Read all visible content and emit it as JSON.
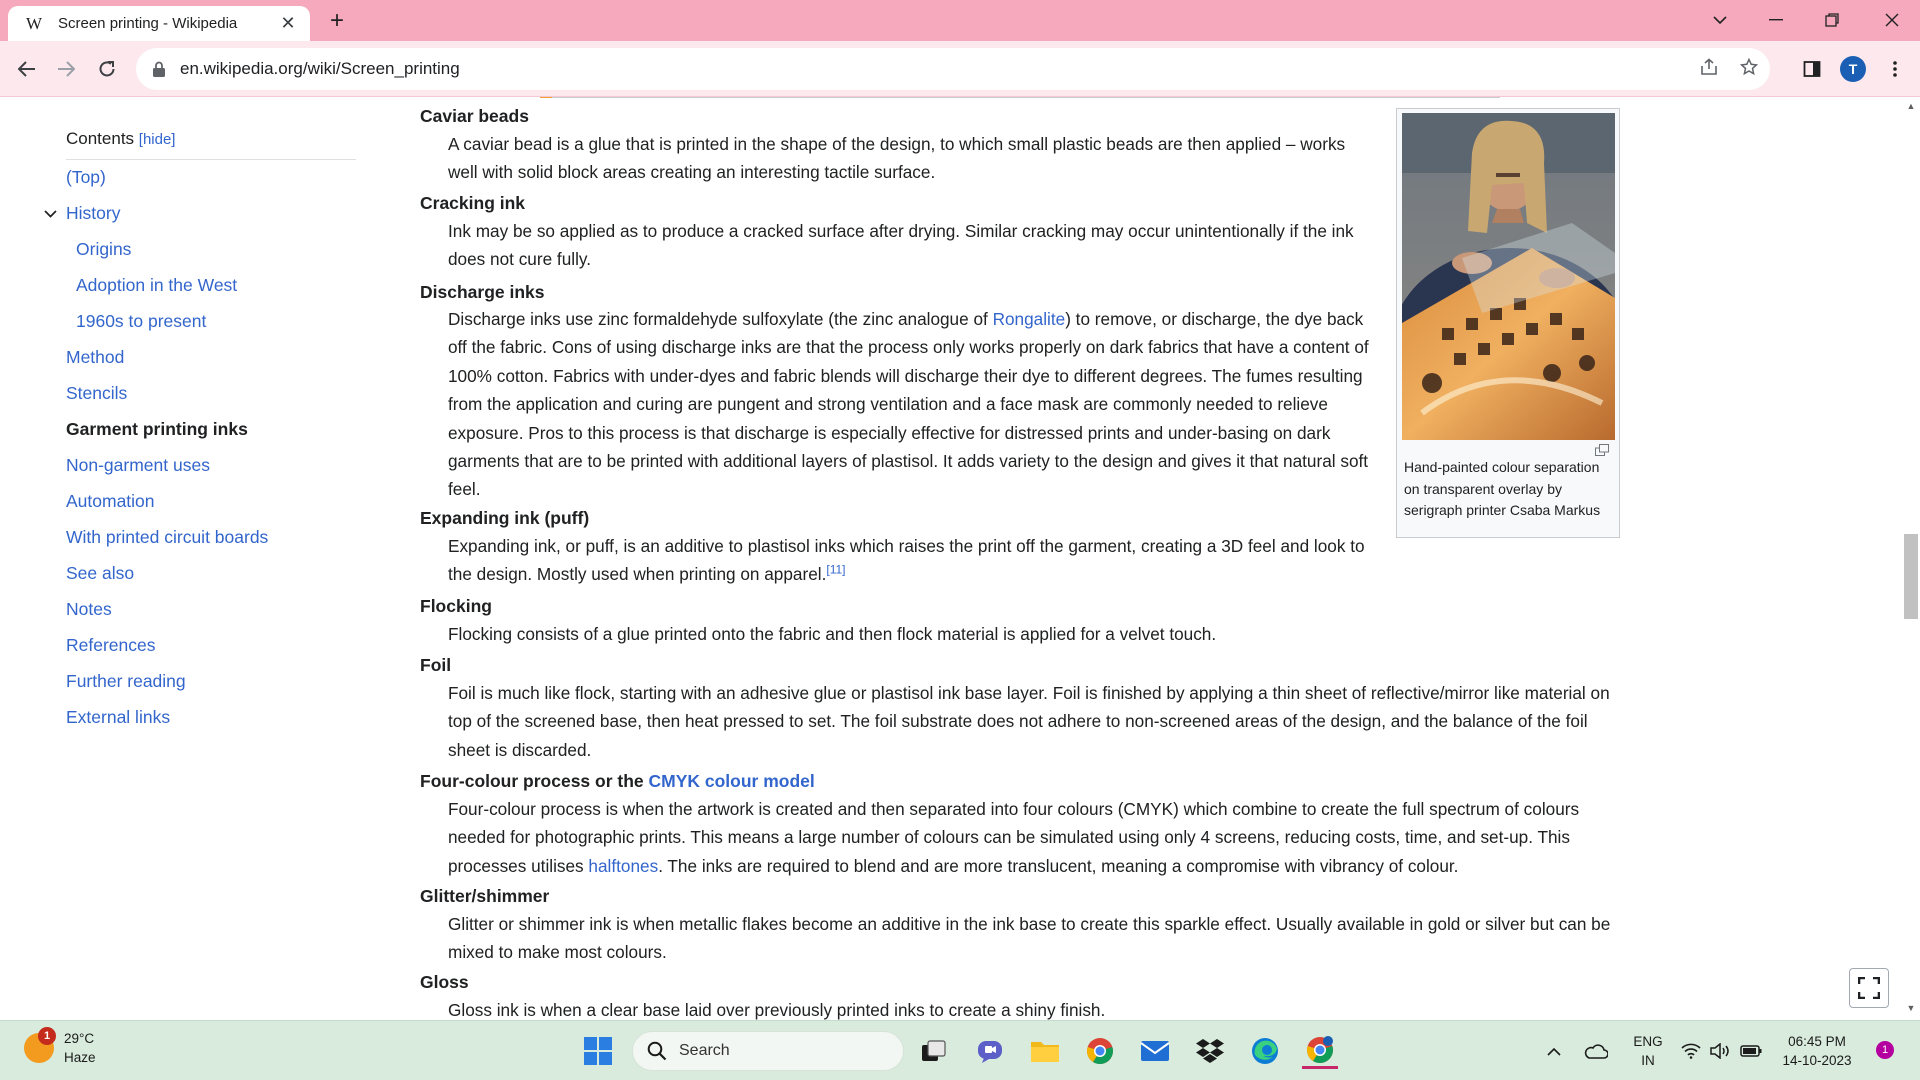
{
  "browser": {
    "tab_title": "Screen printing - Wikipedia",
    "tab_favicon": "W",
    "url": "en.wikipedia.org/wiki/Screen_printing",
    "profile_initial": "T",
    "accent": "#f6a9bd"
  },
  "toc": {
    "heading": "Contents",
    "hide_label": "[hide]",
    "items": [
      {
        "label": "(Top)"
      },
      {
        "label": "History"
      },
      {
        "label": "Origins"
      },
      {
        "label": "Adoption in the West"
      },
      {
        "label": "1960s to present"
      },
      {
        "label": "Method"
      },
      {
        "label": "Stencils"
      },
      {
        "label": "Garment printing inks"
      },
      {
        "label": "Non-garment uses"
      },
      {
        "label": "Automation"
      },
      {
        "label": "With printed circuit boards"
      },
      {
        "label": "See also"
      },
      {
        "label": "Notes"
      },
      {
        "label": "References"
      },
      {
        "label": "Further reading"
      },
      {
        "label": "External links"
      }
    ]
  },
  "article": {
    "caviar": {
      "term": "Caviar beads",
      "text": "A caviar bead is a glue that is printed in the shape of the design, to which small plastic beads are then applied – works well with solid block areas creating an interesting tactile surface."
    },
    "cracking": {
      "term": "Cracking ink",
      "text": "Ink may be so applied as to produce a cracked surface after drying. Similar cracking may occur unintentionally if the ink does not cure fully."
    },
    "discharge": {
      "term": "Discharge inks",
      "before": "Discharge inks use zinc formaldehyde sulfoxylate (the zinc analogue of ",
      "link": "Rongalite",
      "after": ") to remove, or discharge, the dye back off the fabric. Cons of using discharge inks are that the process only works properly on dark fabrics that have a content of 100% cotton. Fabrics with under-dyes and fabric blends will discharge their dye to different degrees. The fumes resulting from the application and curing are pungent and strong ventilation and a face mask are commonly needed to relieve exposure. Pros to this process is that discharge is especially effective for distressed prints and under-basing on dark garments that are to be printed with additional layers of plastisol. It adds variety to the design and gives it that natural soft feel."
    },
    "expanding": {
      "term": "Expanding ink (puff)",
      "text": "Expanding ink, or puff, is an additive to plastisol inks which raises the print off the garment, creating a 3D feel and look to the design. Mostly used when printing on apparel.",
      "ref": "[11]"
    },
    "flocking": {
      "term": "Flocking",
      "text": "Flocking consists of a glue printed onto the fabric and then flock material is applied for a velvet touch."
    },
    "foil": {
      "term": "Foil",
      "text": "Foil is much like flock, starting with an adhesive glue or plastisol ink base layer. Foil is finished by applying a thin sheet of reflective/mirror like material on top of the screened base, then heat pressed to set. The foil substrate does not adhere to non-screened areas of the design, and the balance of the foil sheet is discarded."
    },
    "fourcolour": {
      "term_before": "Four-colour process or the ",
      "term_link": "CMYK colour model",
      "before": "Four-colour process is when the artwork is created and then separated into four colours (CMYK) which combine to create the full spectrum of colours needed for photographic prints. This means a large number of colours can be simulated using only 4 screens, reducing costs, time, and set-up. This processes utilises ",
      "link": "halftones",
      "after": ". The inks are required to blend and are more translucent, meaning a compromise with vibrancy of colour."
    },
    "glitter": {
      "term": "Glitter/shimmer",
      "text": "Glitter or shimmer ink is when metallic flakes become an additive in the ink base to create this sparkle effect. Usually available in gold or silver but can be mixed to make most colours."
    },
    "gloss": {
      "term": "Gloss",
      "text": "Gloss ink is when a clear base laid over previously printed inks to create a shiny finish."
    }
  },
  "figure": {
    "caption": "Hand-painted colour separation on transparent overlay by serigraph printer Csaba Markus"
  },
  "taskbar": {
    "temperature": "29°C",
    "condition": "Haze",
    "weather_badge": "1",
    "search_label": "Search",
    "lang_top": "ENG",
    "lang_bottom": "IN",
    "time": "06:45 PM",
    "date": "14-10-2023",
    "notification_count": "1"
  }
}
